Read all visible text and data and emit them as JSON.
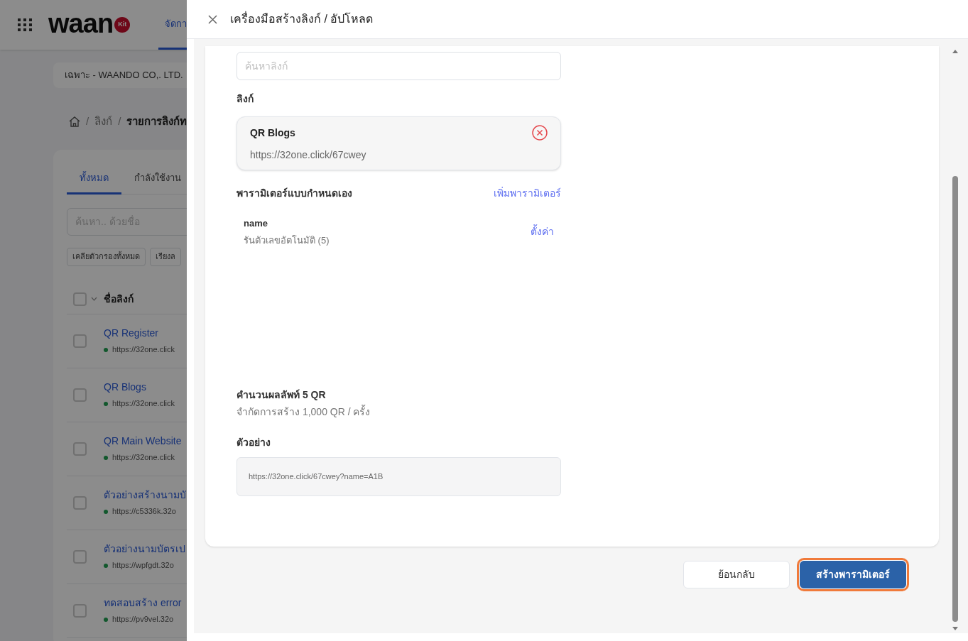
{
  "background_page": {
    "logo_text": "waan",
    "logo_badge": "Kit",
    "nav_tabs": [
      {
        "label": "จัดกา",
        "selected": true
      }
    ],
    "company_selector": "เฉพาะ - WAANDO CO,. LTD.",
    "breadcrumb": {
      "separator": "/",
      "items": [
        "ลิงก์",
        "รายการลิงก์ท"
      ]
    },
    "tabs": [
      {
        "label": "ทั้งหมด",
        "selected": true
      },
      {
        "label": "กำลังใช้งาน",
        "selected": false
      }
    ],
    "search": {
      "placeholder": "ค้นหา.. ด้วยชื่อ"
    },
    "filter_buttons": [
      "เคลียตัวกรองทั้งหมด",
      "เรียงล"
    ],
    "table": {
      "header_checked": false,
      "columns": [
        "ชื่อลิงก์"
      ],
      "rows": [
        {
          "name": "QR Register",
          "url": "https://32one.click",
          "checked": false,
          "active": true
        },
        {
          "name": "QR Blogs",
          "url": "https://32one.click",
          "checked": false,
          "active": true
        },
        {
          "name": "QR Main Website",
          "url": "https://32one.click",
          "checked": false,
          "active": true
        },
        {
          "name": "ตัวอย่างสร้างนามบั",
          "url": "https://c5336k.32o",
          "checked": false,
          "active": true
        },
        {
          "name": "ตัวอย่างนามบัตรเป",
          "url": "https://wpfgdt.32o",
          "checked": false,
          "active": true
        },
        {
          "name": "ทดสอบสร้าง error",
          "url": "https://pv9vel.32o",
          "checked": false,
          "active": true
        }
      ]
    }
  },
  "drawer": {
    "title": "เครื่องมือสร้างลิงก์ / อัปโหลด",
    "search": {
      "placeholder": "ค้นหาลิงก์"
    },
    "link_label": "ลิงก์",
    "selected_link": {
      "name": "QR Blogs",
      "url": "https://32one.click/67cwey"
    },
    "parameters_title": "พารามิเตอร์แบบกำหนดเอง",
    "add_parameter": "เพิ่มพารามิเตอร์",
    "parameters": [
      {
        "name": "name",
        "description": "รันตัวเลขอัตโนมัติ (5)",
        "action": "ตั้งค่า"
      }
    ],
    "result_summary": "คำนวนผลลัพท์ 5 QR",
    "limit_note": "จำกัดการสร้าง 1,000 QR / ครั้ง",
    "example_label": "ตัวอย่าง",
    "example_value": "https://32one.click/67cwey?name=A1B",
    "buttons": [
      {
        "label": "ย้อนกลับ",
        "kind": "secondary",
        "focused": false
      },
      {
        "label": "สร้างพารามิเตอร์",
        "kind": "primary",
        "focused": true
      }
    ]
  }
}
